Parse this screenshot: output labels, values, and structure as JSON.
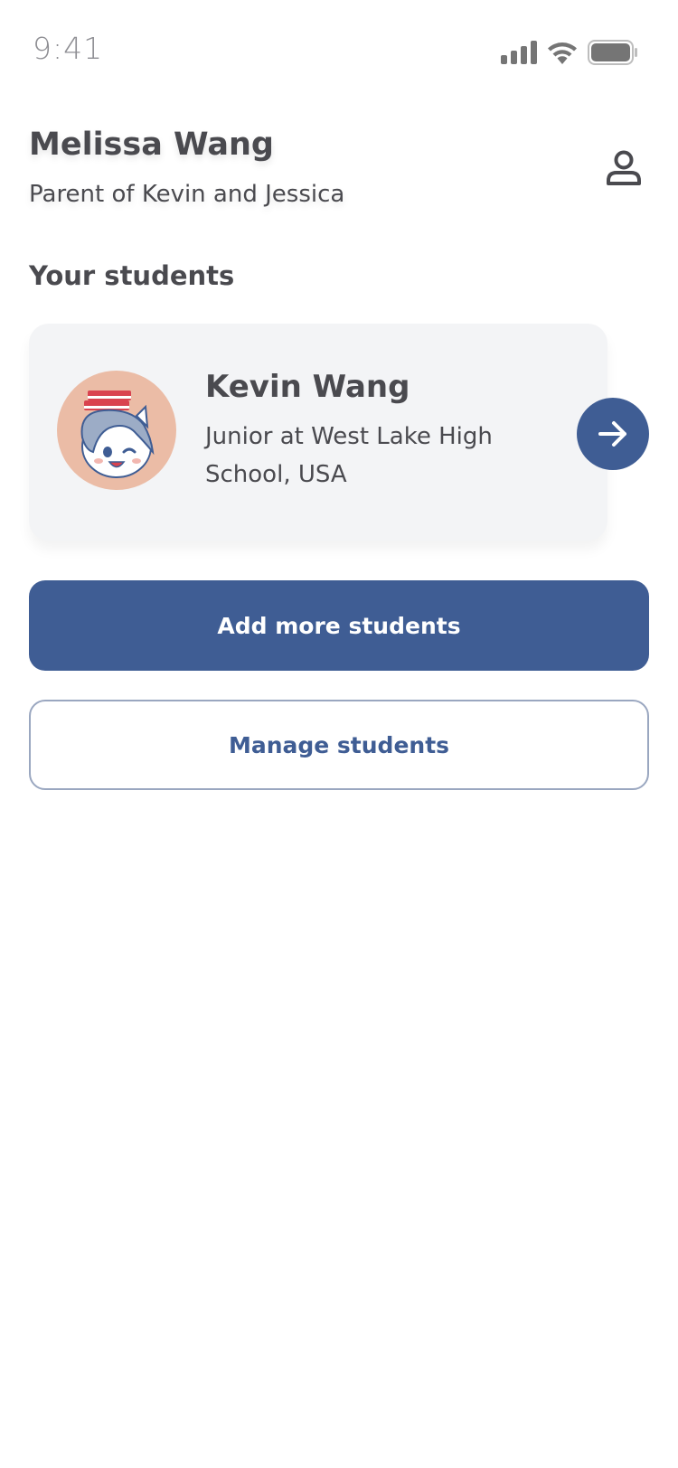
{
  "status_bar": {
    "time": "9:41",
    "icons": [
      "signal-icon",
      "wifi-icon",
      "battery-icon"
    ]
  },
  "header": {
    "name": "Melissa Wang",
    "role": "Parent of Kevin and Jessica",
    "profile_icon": "person-icon"
  },
  "students_section": {
    "title": "Your students",
    "students": [
      {
        "name": "Kevin Wang",
        "info": "Junior at West Lake High School, USA",
        "avatar": "unicorn-avatar",
        "action_icon": "arrow-right-icon"
      }
    ]
  },
  "actions": {
    "add_label": "Add more students",
    "manage_label": "Manage students"
  },
  "colors": {
    "primary": "#3f5d94",
    "card_bg": "#f3f4f6",
    "avatar_bg": "#ebbca6",
    "text": "#4a4a4f"
  }
}
